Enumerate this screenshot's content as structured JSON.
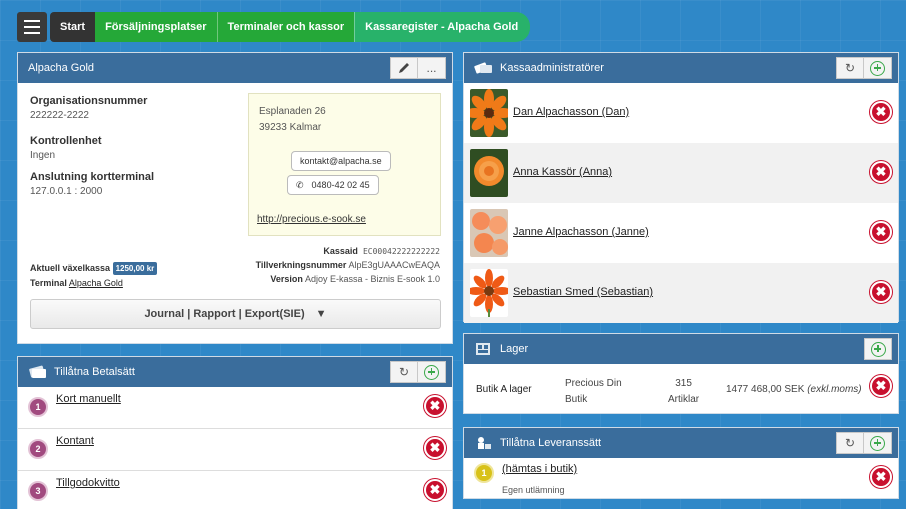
{
  "breadcrumb": {
    "items": [
      "Start",
      "Försäljningsplatser",
      "Terminaler och kassor",
      "Kassaregister - Alpacha Gold"
    ]
  },
  "alpacha": {
    "title": "Alpacha Gold",
    "edit_icon": "pencil-icon",
    "more_label": "...",
    "org_label": "Organisationsnummer",
    "org_value": "222222-2222",
    "control_label": "Kontrollenhet",
    "control_value": "Ingen",
    "conn_label": "Anslutning kortterminal",
    "conn_value": "127.0.0.1 : 2000",
    "address_line1": "Esplanaden 26",
    "address_line2": "39233 Kalmar",
    "email": "kontakt@alpacha.se",
    "phone": "0480-42   02   45",
    "website": "http://precious.e-sook.se",
    "current_label": "Aktuell växelkassa",
    "current_value": "1250,00 kr",
    "terminal_label": "Terminal",
    "terminal_value": "Alpacha Gold",
    "kassaid_label": "Kassaid",
    "kassaid_value": "EC00042222222222",
    "serial_label": "Tillverkningsnummer",
    "serial_value": "AlpE3gUAAACwEAQA",
    "version_label": "Version",
    "version_value": "Adjoy E-kassa - Biznis E-sook 1.0",
    "journal_label": "Journal | Rapport | Export(SIE)"
  },
  "betal": {
    "title": "Tillåtna Betalsätt",
    "items": [
      {
        "num": "1",
        "label": "Kort manuellt"
      },
      {
        "num": "2",
        "label": "Kontant"
      },
      {
        "num": "3",
        "label": "Tillgodokvitto"
      }
    ]
  },
  "admin": {
    "title": "Kassaadministratörer",
    "items": [
      {
        "name": "Dan Alpachasson (Dan)"
      },
      {
        "name": "Anna Kassör (Anna)"
      },
      {
        "name": "Janne Alpachasson (Janne)"
      },
      {
        "name": "Sebastian Smed (Sebastian)"
      }
    ]
  },
  "lager": {
    "title": "Lager",
    "store": "Butik A lager",
    "owner_line1": "Precious Din",
    "owner_line2": "Butik",
    "count_line1": "315",
    "count_line2": "Artiklar",
    "value": "1477 468,00 SEK",
    "value_note": "(exkl.moms)"
  },
  "lev": {
    "title": "Tillåtna Leveranssätt",
    "num": "1",
    "label": "(hämtas i butik)",
    "sub": "Egen utlämning"
  },
  "colors": {
    "header": "#3a6d9c",
    "delete": "#c8102e",
    "add": "#3aa84a",
    "crumb_green": "#25a838",
    "pay_badge": "#a14a7f",
    "delivery_badge": "#d8c21a"
  }
}
